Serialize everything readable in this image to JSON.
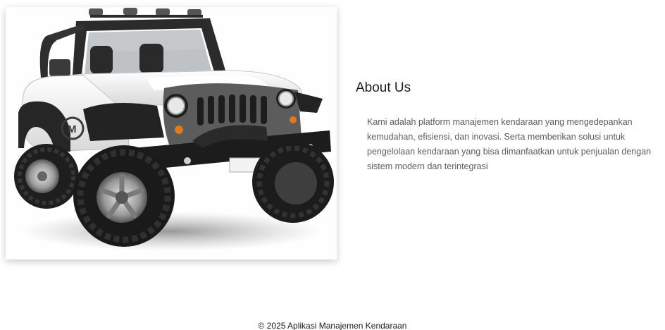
{
  "about": {
    "title": "About Us",
    "description": "Kami adalah platform manajemen kendaraan yang mengedepankan kemudahan, efisiensi, dan inovasi. Serta memberikan solusi untuk pengelolaan kendaraan yang bisa dimanfaatkan untuk penjualan dengan sistem modern dan terintegrasi"
  },
  "footer": {
    "copyright": "© 2025 Aplikasi Manajemen Kendaraan"
  },
  "colors": {
    "background": "#ffffff",
    "heading": "#1d1d1d",
    "body_text": "#5c5c5c",
    "vehicle_body": "#f2f2f2",
    "tire": "#1e1e1e"
  }
}
